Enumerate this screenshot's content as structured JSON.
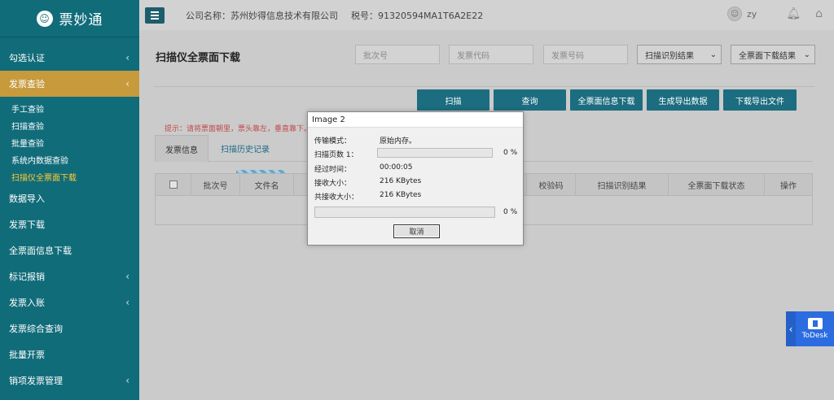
{
  "brand": {
    "logo_glyph": "☺",
    "name": "票妙通"
  },
  "sidebar": {
    "items": [
      {
        "label": "勾选认证",
        "chevron": "‹"
      },
      {
        "label": "发票查验",
        "chevron": "‹",
        "active": true
      },
      {
        "label": "数据导入"
      },
      {
        "label": "发票下载"
      },
      {
        "label": "全票面信息下载"
      },
      {
        "label": "标记报销",
        "chevron": "‹"
      },
      {
        "label": "发票入账",
        "chevron": "‹"
      },
      {
        "label": "发票综合查询"
      },
      {
        "label": "批量开票"
      },
      {
        "label": "销项发票管理",
        "chevron": "‹"
      }
    ],
    "sub_items": [
      "手工查验",
      "扫描查验",
      "批量查验",
      "系统内数据查验",
      "扫描仪全票面下载"
    ]
  },
  "topbar": {
    "company": "公司名称：苏州妙得信息技术有限公司",
    "tax": "税号：91320594MA1T6A2E22",
    "user": "zy",
    "icons": {
      "menu": "hamburger-icon",
      "bell": "bell-icon",
      "home": "home-icon"
    }
  },
  "page": {
    "title": "扫描仪全票面下载",
    "filters": {
      "batch_placeholder": "批次号",
      "code_placeholder": "发票代码",
      "number_placeholder": "发票号码",
      "scan_result": "扫描识别结果",
      "download_result": "全票面下载结果"
    },
    "buttons": [
      "扫描",
      "查询",
      "全票面信息下载",
      "生成导出数据",
      "下载导出文件"
    ],
    "hint": "提示：请将票面朝里，票头靠左，垂直靠下。",
    "tabs": [
      "发票信息",
      "扫描历史记录"
    ],
    "columns": [
      "批次号",
      "文件名",
      "校验码",
      "扫描识别结果",
      "全票面下载状态",
      "操作"
    ]
  },
  "dialog": {
    "title": "Image 2",
    "transfer_mode_label": "传输模式：",
    "transfer_mode_value": "原始内存。",
    "pages_label": "扫描页数 1：",
    "pages_pct": "0 %",
    "elapsed_label": "经过时间：",
    "elapsed_value": "00:00:05",
    "received_label": "接收大小：",
    "received_value": "216 KBytes",
    "total_label": "共接收大小：",
    "total_value": "216 KBytes",
    "overall_pct": "0 %",
    "cancel": "取消"
  },
  "todesk": {
    "label": "ToDesk",
    "arrow": "‹"
  },
  "colors": {
    "sidebar": "#116c7a",
    "active": "#c79a3c",
    "button": "#1c6d80",
    "hint": "#c24a4a"
  }
}
